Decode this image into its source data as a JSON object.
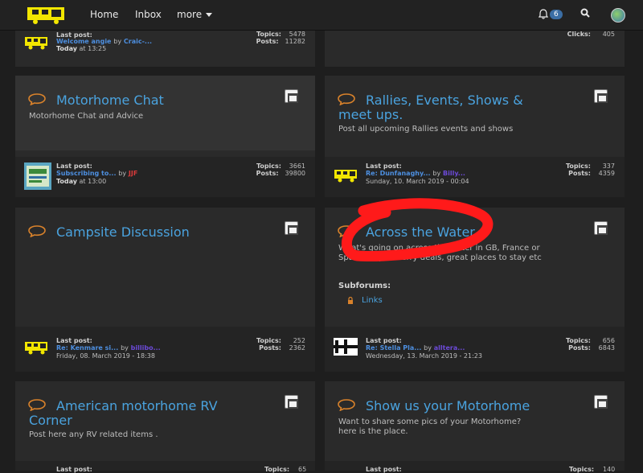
{
  "nav": {
    "home": "Home",
    "inbox": "Inbox",
    "more": "more",
    "notifications_count": "6"
  },
  "cards": {
    "top_left": {
      "last_post_label": "Last post:",
      "last_post_title": "Welcome angie",
      "by": "by",
      "user": "Craic-...",
      "time_day": "Today",
      "time_rest": "at 13:25",
      "topics_label": "Topics:",
      "topics": "5478",
      "posts_label": "Posts:",
      "posts": "11282"
    },
    "top_right": {
      "clicks_label": "Clicks:",
      "clicks": "405"
    },
    "motorhome_chat": {
      "title": "Motorhome Chat",
      "desc": "Motorhome Chat and Advice",
      "last_post_label": "Last post:",
      "last_post_title": "Subscribing to...",
      "by": "by",
      "user": "JJF",
      "time_day": "Today",
      "time_rest": "at 13:00",
      "topics_label": "Topics:",
      "topics": "3661",
      "posts_label": "Posts:",
      "posts": "39800"
    },
    "rallies": {
      "title": "Rallies, Events, Shows & meet ups.",
      "desc": "Post all upcoming Rallies events and shows",
      "last_post_label": "Last post:",
      "last_post_title": "Re: Dunfanaghy...",
      "by": "by",
      "user": "Billy...",
      "time": "Sunday, 10. March 2019 - 00:04",
      "topics_label": "Topics:",
      "topics": "337",
      "posts_label": "Posts:",
      "posts": "4359"
    },
    "campsite": {
      "title": "Campsite Discussion",
      "last_post_label": "Last post:",
      "last_post_title": "Re: Kenmare si...",
      "by": "by",
      "user": "billibo...",
      "time": "Friday, 08. March 2019 - 18:38",
      "topics_label": "Topics:",
      "topics": "252",
      "posts_label": "Posts:",
      "posts": "2362"
    },
    "across_water": {
      "title": "Across the Water",
      "desc": "What's going on across the water in GB, France or Spain, Eu post ferry deals, great places to stay etc",
      "subforums_label": "Subforums:",
      "subforum_link": "Links",
      "last_post_label": "Last post:",
      "last_post_title": "Re: Stella Pla...",
      "by": "by",
      "user": "alltera...",
      "time": "Wednesday, 13. March 2019 - 21:23",
      "topics_label": "Topics:",
      "topics": "656",
      "posts_label": "Posts:",
      "posts": "6843"
    },
    "american_rv": {
      "title": "American motorhome RV Corner",
      "desc": "Post here any RV related items .",
      "last_post_label": "Last post:",
      "topics_label": "Topics:",
      "topics": "65"
    },
    "show_us": {
      "title": "Show us your Motorhome",
      "desc": "Want to share some pics of your Motorhome? here is the place.",
      "last_post_label": "Last post:",
      "topics_label": "Topics:",
      "topics": "140"
    }
  },
  "colors": {
    "accent": "#4aa3df",
    "bubble": "#d9822b",
    "logo": "#f2e600",
    "annotation": "#ff1a1a"
  }
}
